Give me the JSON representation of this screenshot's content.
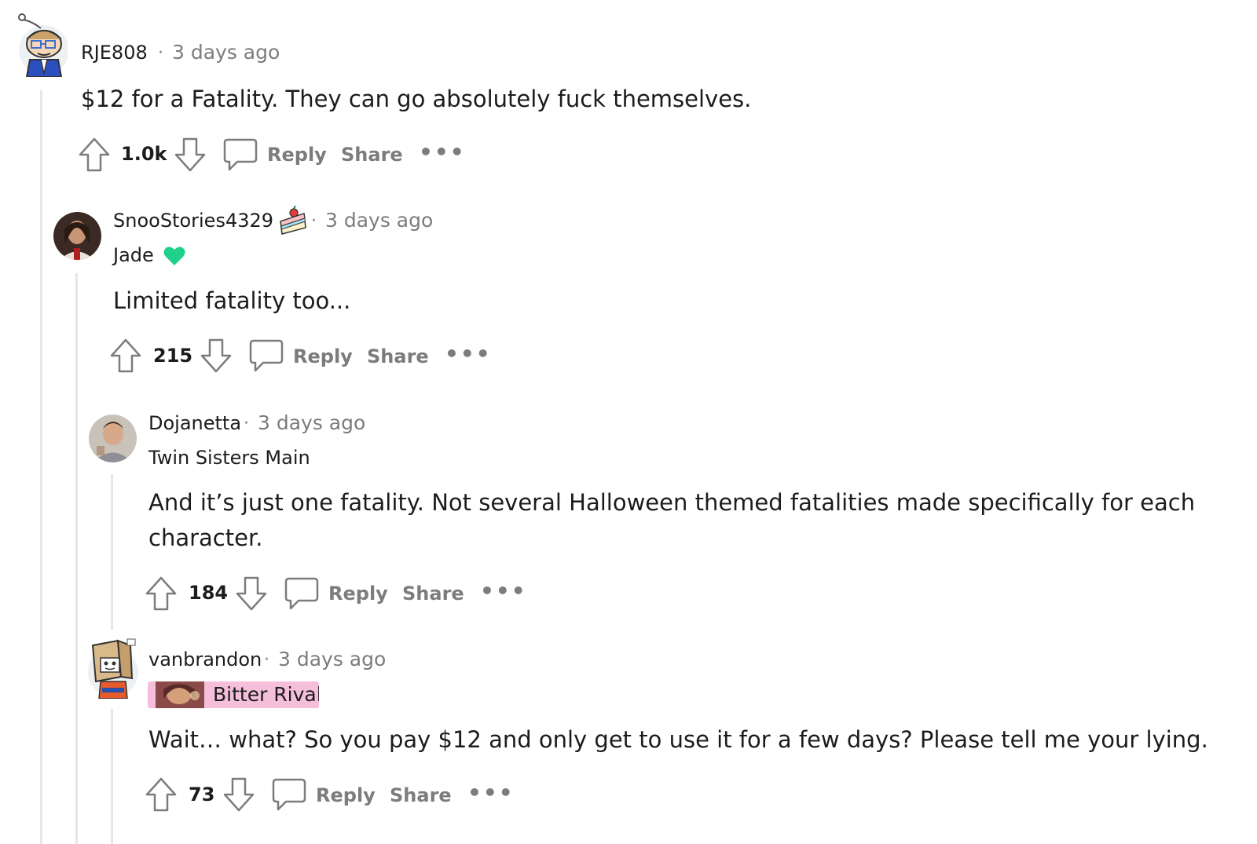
{
  "comments": [
    {
      "username": "RJE808",
      "separator": "·",
      "timestamp": "3 days ago",
      "body": "$12 for a Fatality. They can go absolutely fuck themselves.",
      "votes": "1.0k",
      "reply_label": "Reply",
      "share_label": "Share",
      "more_label": "•••"
    },
    {
      "username": "SnooStories4329",
      "separator": "·",
      "timestamp": "3 days ago",
      "flair": "Jade",
      "body": "Limited fatality too...",
      "votes": "215",
      "reply_label": "Reply",
      "share_label": "Share",
      "more_label": "•••"
    },
    {
      "username": "Dojanetta",
      "separator": "·",
      "timestamp": "3 days ago",
      "flair": "Twin Sisters Main",
      "body_line1": "And it’s just one fatality. Not several Halloween themed fatalities made specifically for each",
      "body_line2": "character.",
      "votes": "184",
      "reply_label": "Reply",
      "share_label": "Share",
      "more_label": "•••"
    },
    {
      "username": "vanbrandon",
      "separator": "·",
      "timestamp": "3 days ago",
      "flair": "Bitter Rival",
      "body": "Wait… what? So you pay $12 and only get to use it for a few days? Please tell me your lying.",
      "votes": "73",
      "reply_label": "Reply",
      "share_label": "Share",
      "more_label": "•••"
    }
  ],
  "colors": {
    "text": "#1c1c1c",
    "muted": "#7c7c7c",
    "thread_line": "#e6e6e6",
    "jade_heart": "#1fd18a",
    "flair_pink": "#f5bfd9"
  }
}
